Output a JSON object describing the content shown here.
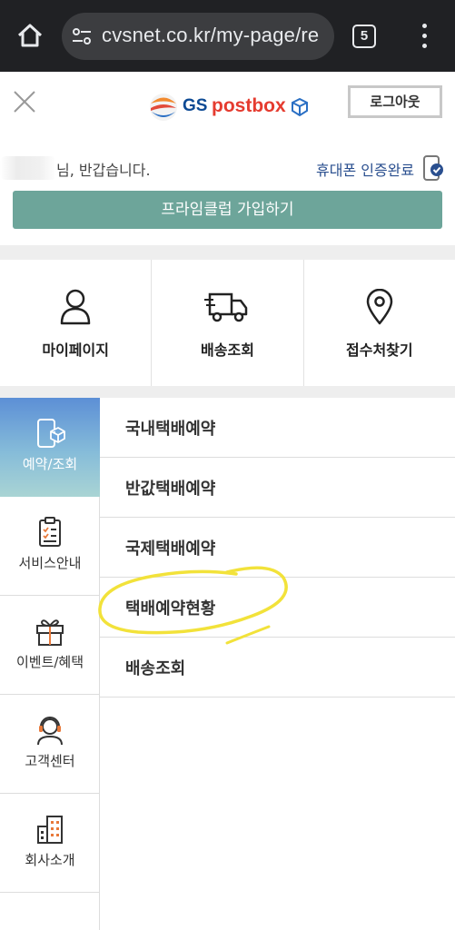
{
  "browser": {
    "url": "cvsnet.co.kr/my-page/re",
    "tab_count": "5"
  },
  "header": {
    "logo_gs": "GS",
    "logo_brand": "postbox",
    "logout_label": "로그아웃"
  },
  "greeting": {
    "text": "님, 반갑습니다.",
    "verify_text": "휴대폰 인증완료"
  },
  "prime_button": "프라임클럽 가입하기",
  "quick_menu": [
    {
      "label": "마이페이지",
      "icon": "person-icon"
    },
    {
      "label": "배송조회",
      "icon": "delivery-truck-icon"
    },
    {
      "label": "접수처찾기",
      "icon": "location-pin-icon"
    }
  ],
  "sidebar": [
    {
      "label": "예약/조회",
      "icon": "phone-parcel-icon",
      "active": true
    },
    {
      "label": "서비스안내",
      "icon": "clipboard-icon"
    },
    {
      "label": "이벤트/혜택",
      "icon": "gift-icon"
    },
    {
      "label": "고객센터",
      "icon": "headset-agent-icon"
    },
    {
      "label": "회사소개",
      "icon": "building-icon"
    }
  ],
  "submenu": [
    {
      "label": "국내택배예약"
    },
    {
      "label": "반값택배예약"
    },
    {
      "label": "국제택배예약"
    },
    {
      "label": "택배예약현황"
    },
    {
      "label": "배송조회"
    }
  ],
  "colors": {
    "browser_bar": "#202124",
    "prime_button": "#6da59a",
    "active_sidebar_top": "#5c8fd6",
    "highlight": "#f2e23a",
    "verify_text": "#2a4f8f"
  }
}
